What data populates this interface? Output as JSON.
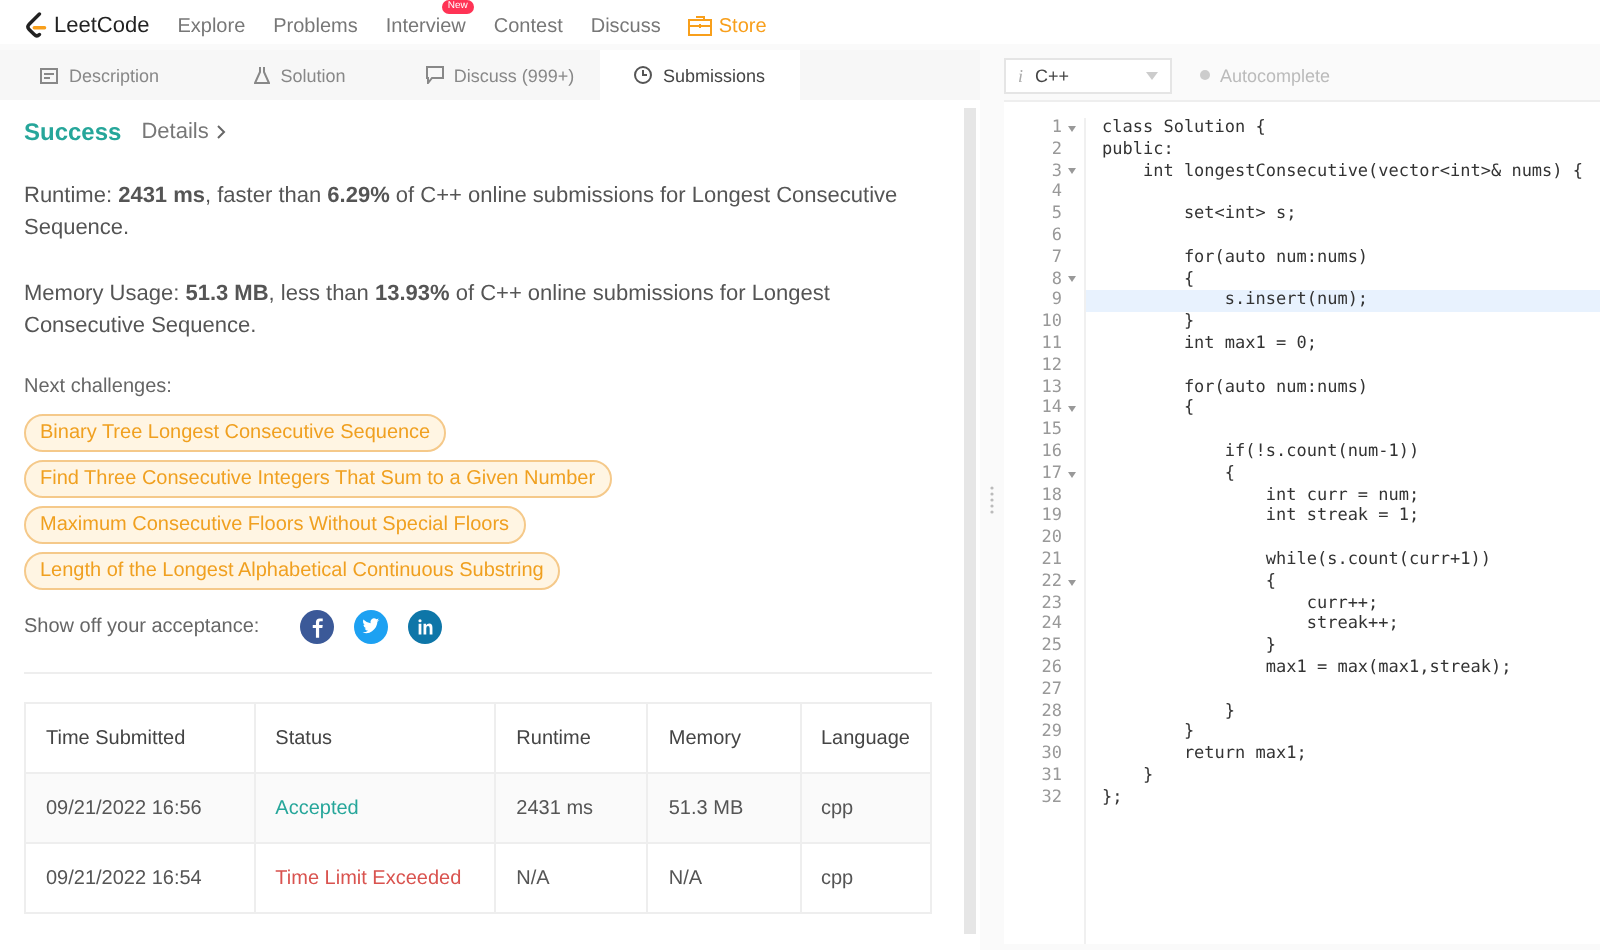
{
  "nav": {
    "logo": "LeetCode",
    "items": [
      {
        "label": "Explore",
        "kind": "link"
      },
      {
        "label": "Problems",
        "kind": "link"
      },
      {
        "label": "Interview",
        "kind": "link",
        "badge": "New"
      },
      {
        "label": "Contest",
        "kind": "link"
      },
      {
        "label": "Discuss",
        "kind": "link"
      },
      {
        "label": "Store",
        "kind": "store"
      }
    ]
  },
  "tabs": [
    {
      "label": "Description",
      "selected": false
    },
    {
      "label": "Solution",
      "selected": false
    },
    {
      "label": "Discuss (999+)",
      "selected": false
    },
    {
      "label": "Submissions",
      "selected": true
    }
  ],
  "result": {
    "status": "Success",
    "details": "Details",
    "runtime": "Runtime: **2431 ms**, faster than **6.29%** of C++ online submissions for Longest Consecutive Sequence.",
    "memory": "Memory Usage: **51.3 MB**, less than **13.93%** of C++ online submissions for Longest Consecutive Sequence.",
    "next_label": "Next challenges:",
    "challenges": [
      "Binary Tree Longest Consecutive Sequence",
      "Find Three Consecutive Integers That Sum to a Given Number",
      "Maximum Consecutive Floors Without Special Floors",
      "Length of the Longest Alphabetical Continuous Substring"
    ],
    "share_label": "Show off your acceptance:",
    "share": [
      {
        "kind": "facebook",
        "color": "#3b5998"
      },
      {
        "kind": "twitter",
        "color": "#1da1f2"
      },
      {
        "kind": "linkedin",
        "color": "#0e76a8"
      }
    ]
  },
  "table": {
    "columns": [
      "Time Submitted",
      "Status",
      "Runtime",
      "Memory",
      "Language"
    ],
    "rows": [
      {
        "time": "09/21/2022 16:56",
        "status": "Accepted",
        "kind": "accepted",
        "runtime": "2431 ms",
        "memory": "51.3 MB",
        "language": "cpp"
      },
      {
        "time": "09/21/2022 16:54",
        "status": "Time Limit Exceeded",
        "kind": "error",
        "runtime": "N/A",
        "memory": "N/A",
        "language": "cpp"
      }
    ]
  },
  "editor": {
    "language": "C++",
    "language_icon": "i",
    "autocomplete": "Autocomplete",
    "lines": [
      {
        "number": "1",
        "foldable": true,
        "highlighted": false,
        "code": "class Solution {"
      },
      {
        "number": "2",
        "foldable": false,
        "highlighted": false,
        "code": "public:"
      },
      {
        "number": "3",
        "foldable": true,
        "highlighted": false,
        "code": "    int longestConsecutive(vector<int>& nums) {"
      },
      {
        "number": "4",
        "foldable": false,
        "highlighted": false
      },
      {
        "number": "5",
        "foldable": false,
        "highlighted": false,
        "code": "        set<int> s;"
      },
      {
        "number": "6",
        "foldable": false,
        "highlighted": false
      },
      {
        "number": "7",
        "foldable": false,
        "highlighted": false,
        "code": "        for(auto num:nums)"
      },
      {
        "number": "8",
        "foldable": true,
        "highlighted": false,
        "code": "        {"
      },
      {
        "number": "9",
        "foldable": false,
        "highlighted": true,
        "code": "            s.insert(num);"
      },
      {
        "number": "10",
        "foldable": false,
        "highlighted": false,
        "code": "        }"
      },
      {
        "number": "11",
        "foldable": false,
        "highlighted": false,
        "code": "        int max1 = 0;"
      },
      {
        "number": "12",
        "foldable": false,
        "highlighted": false
      },
      {
        "number": "13",
        "foldable": false,
        "highlighted": false,
        "code": "        for(auto num:nums)"
      },
      {
        "number": "14",
        "foldable": true,
        "highlighted": false,
        "code": "        {"
      },
      {
        "number": "15",
        "foldable": false,
        "highlighted": false
      },
      {
        "number": "16",
        "foldable": false,
        "highlighted": false,
        "code": "            if(!s.count(num-1))"
      },
      {
        "number": "17",
        "foldable": true,
        "highlighted": false,
        "code": "            {"
      },
      {
        "number": "18",
        "foldable": false,
        "highlighted": false,
        "code": "                int curr = num;"
      },
      {
        "number": "19",
        "foldable": false,
        "highlighted": false,
        "code": "                int streak = 1;"
      },
      {
        "number": "20",
        "foldable": false,
        "highlighted": false
      },
      {
        "number": "21",
        "foldable": false,
        "highlighted": false,
        "code": "                while(s.count(curr+1))"
      },
      {
        "number": "22",
        "foldable": true,
        "highlighted": false,
        "code": "                {"
      },
      {
        "number": "23",
        "foldable": false,
        "highlighted": false,
        "code": "                    curr++;"
      },
      {
        "number": "24",
        "foldable": false,
        "highlighted": false,
        "code": "                    streak++;"
      },
      {
        "number": "25",
        "foldable": false,
        "highlighted": false,
        "code": "                }"
      },
      {
        "number": "26",
        "foldable": false,
        "highlighted": false,
        "code": "                max1 = max(max1,streak);"
      },
      {
        "number": "27",
        "foldable": false,
        "highlighted": false
      },
      {
        "number": "28",
        "foldable": false,
        "highlighted": false,
        "code": "            }"
      },
      {
        "number": "29",
        "foldable": false,
        "highlighted": false,
        "code": "        }"
      },
      {
        "number": "30",
        "foldable": false,
        "highlighted": false,
        "code": "        return max1;"
      },
      {
        "number": "31",
        "foldable": false,
        "highlighted": false,
        "code": "    }"
      },
      {
        "number": "32",
        "foldable": false,
        "highlighted": false,
        "code": "};"
      }
    ]
  }
}
